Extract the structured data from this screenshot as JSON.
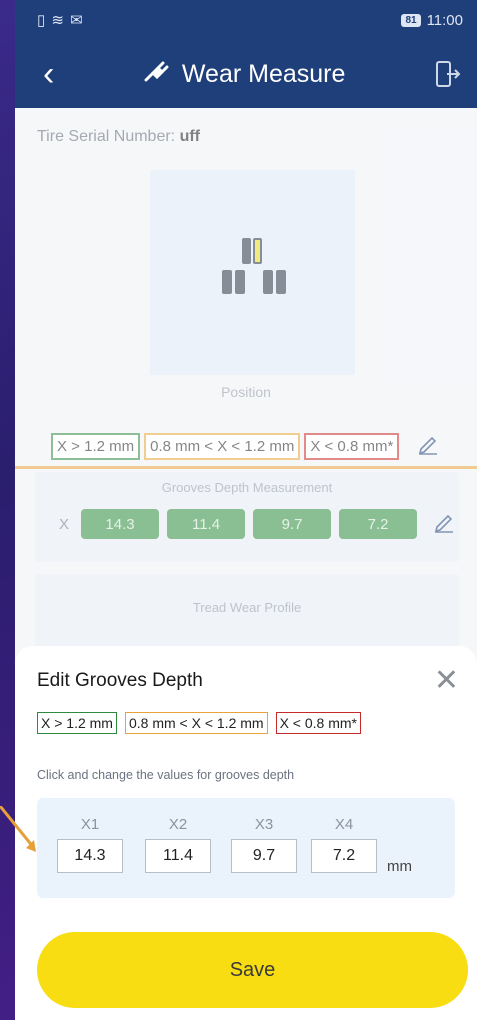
{
  "statusbar": {
    "left_icons": "▯ ≋ ✉",
    "battery": "81",
    "time": "11:00"
  },
  "appbar": {
    "title": "Wear Measure",
    "back_icon": "chevron-left-icon",
    "title_icon": "plug-icon",
    "exit_icon": "exit-door-icon"
  },
  "serial": {
    "label": "Tire Serial Number:",
    "value": "uff"
  },
  "position": {
    "label": "Position"
  },
  "legend": {
    "green": "X > 1.2 mm",
    "orange": "0.8 mm < X < 1.2 mm",
    "red": "X < 0.8 mm*"
  },
  "grooves_card": {
    "title": "Grooves Depth Measurement",
    "prefix": "X",
    "values": [
      "14.3",
      "11.4",
      "9.7",
      "7.2"
    ]
  },
  "tread_card": {
    "title": "Tread Wear Profile"
  },
  "sheet": {
    "title": "Edit Grooves Depth",
    "hint": "Click and change the values for grooves depth",
    "labels": [
      "X1",
      "X2",
      "X3",
      "X4"
    ],
    "values": [
      "14.3",
      "11.4",
      "9.7",
      "7.2"
    ],
    "unit": "mm",
    "save_label": "Save"
  },
  "colors": {
    "appbar": "#1e3f7a",
    "green": "#2e8b3e",
    "orange": "#e8a43a",
    "red": "#c62b2b",
    "save": "#f7dd12"
  }
}
